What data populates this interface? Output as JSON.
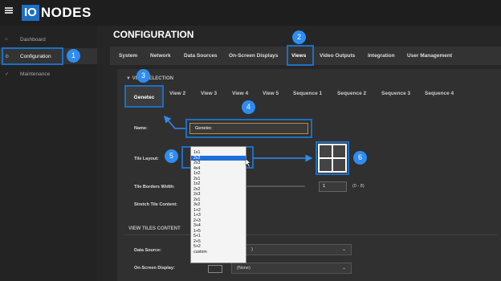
{
  "header": {
    "logo_mark": "IO",
    "logo_text": "NODES"
  },
  "sidebar": {
    "items": [
      {
        "label": "Dashboard",
        "icon": "home-icon"
      },
      {
        "label": "Configuration",
        "icon": "gear-icon"
      },
      {
        "label": "Maintenance",
        "icon": "wrench-icon"
      }
    ]
  },
  "page": {
    "title": "CONFIGURATION"
  },
  "config_tabs": [
    "System",
    "Network",
    "Data Sources",
    "On-Screen Displays",
    "Views",
    "Video Outputs",
    "Integration",
    "User Management"
  ],
  "view_section": {
    "title": "VIEW SELECTION",
    "tabs": [
      "Genetec",
      "View 2",
      "View 3",
      "View 4",
      "View 5",
      "Sequence 1",
      "Sequence 2",
      "Sequence 3",
      "Sequence 4"
    ]
  },
  "form": {
    "name_label": "Name:",
    "name_value": "Genetec",
    "tile_layout_label": "Tile Layout:",
    "tile_borders_label": "Tile Borders Width:",
    "tile_borders_value": "1",
    "tile_borders_range": "(0 - 8)",
    "stretch_label": "Stretch Tile Content:"
  },
  "layout_options": [
    "1x1",
    "2x2",
    "2x3",
    "4x4",
    "1x2",
    "2x1",
    "1x2",
    "2x2",
    "2x3",
    "2v1",
    "3v2",
    "1+2",
    "1+3",
    "2+3",
    "3+4",
    "1+5",
    "5+1",
    "2+5",
    "5+2",
    "custom"
  ],
  "layout_selected_index": 1,
  "tiles_section": {
    "title": "VIEW TILES CONTENT",
    "data_source_label": "Data Source:",
    "data_source_value": ")",
    "osd_label": "On-Screen Display:",
    "osd_value": "(None)"
  },
  "callouts": [
    "1",
    "2",
    "3",
    "4",
    "5",
    "6"
  ],
  "colors": {
    "accent": "#1d6fc4",
    "badge": "#2f8cf0",
    "input_border": "#c28a34",
    "selected": "#1e6fd8"
  }
}
